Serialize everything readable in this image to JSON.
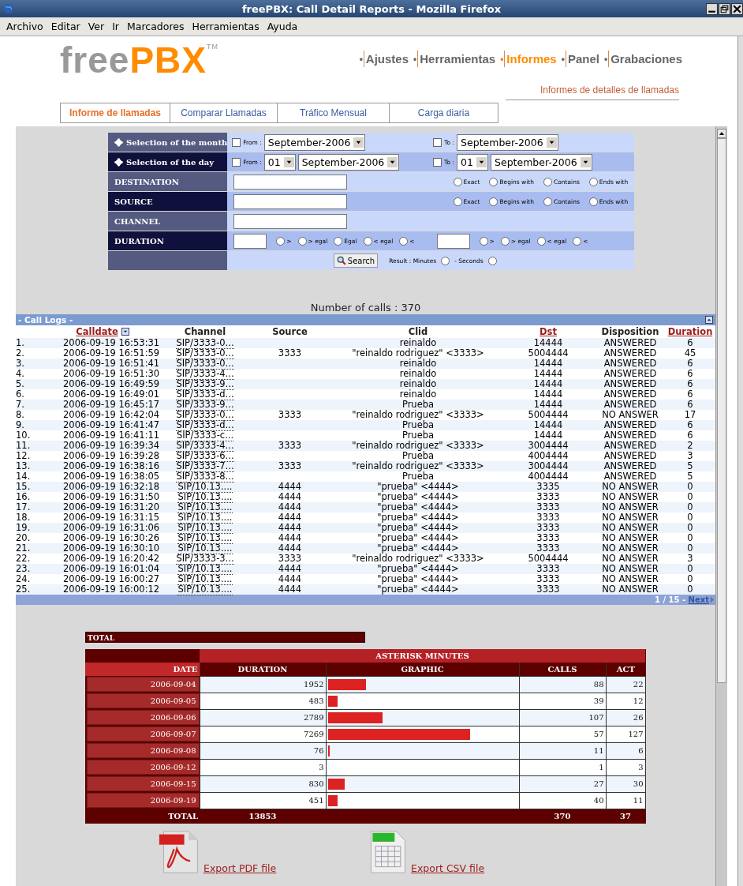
{
  "window": {
    "title": "freePBX: Call Detail Reports - Mozilla Firefox"
  },
  "menu": [
    "Archivo",
    "Editar",
    "Ver",
    "Ir",
    "Marcadores",
    "Herramientas",
    "Ayuda"
  ],
  "logo": {
    "first": "free",
    "second": "PBX",
    "mark": "TM"
  },
  "nav": [
    {
      "bullet": "•",
      "label": "Ajustes",
      "selected": false
    },
    {
      "bullet": "•",
      "label": "Herramientas",
      "selected": false
    },
    {
      "bullet": "•",
      "label": "Informes",
      "selected": true
    },
    {
      "bullet": "•",
      "label": "Panel",
      "selected": false
    },
    {
      "bullet": "•",
      "label": "Grabaciones",
      "selected": false
    }
  ],
  "subtitle": "Informes de detalles de llamadas",
  "tabs": [
    {
      "label": "Informe de llamadas",
      "selected": true
    },
    {
      "label": "Comparar Llamadas",
      "selected": false
    },
    {
      "label": "Tráfico Mensual",
      "selected": false
    },
    {
      "label": "Carga diaria",
      "selected": false
    }
  ],
  "form": {
    "rows": [
      {
        "kind": "month",
        "label": "Selection of the month",
        "from": {
          "label": "From :",
          "checked": false,
          "month": "September-2006"
        },
        "to": {
          "label": "To :",
          "checked": false,
          "month": "September-2006"
        }
      },
      {
        "kind": "day",
        "label": "Selection of the day",
        "from": {
          "label": "From :",
          "checked": false,
          "day": "01",
          "month": "September-2006"
        },
        "to": {
          "label": "To :",
          "checked": false,
          "day": "01",
          "month": "September-2006"
        }
      },
      {
        "kind": "match",
        "label": "DESTINATION",
        "options": [
          {
            "label": "Exact",
            "selected": false
          },
          {
            "label": "Begins with",
            "selected": false
          },
          {
            "label": "Contains",
            "selected": false
          },
          {
            "label": "Ends with",
            "selected": false
          }
        ]
      },
      {
        "kind": "match",
        "label": "SOURCE",
        "options": [
          {
            "label": "Exact",
            "selected": false
          },
          {
            "label": "Begins with",
            "selected": false
          },
          {
            "label": "Contains",
            "selected": false
          },
          {
            "label": "Ends with",
            "selected": false
          }
        ]
      },
      {
        "kind": "text",
        "label": "CHANNEL"
      },
      {
        "kind": "duration",
        "label": "DURATION",
        "options": [
          {
            "label": ">",
            "selected": false
          },
          {
            "label": "> egal",
            "selected": false
          },
          {
            "label": "Egal",
            "selected": false
          },
          {
            "label": "< egal",
            "selected": false
          },
          {
            "label": "<",
            "selected": false
          }
        ],
        "options2": [
          {
            "label": ">",
            "selected": false
          },
          {
            "label": "> egal",
            "selected": false
          },
          {
            "label": "< egal",
            "selected": false
          },
          {
            "label": "<",
            "selected": false
          }
        ]
      },
      {
        "kind": "search",
        "button": "Search",
        "minutes": {
          "label": "Result : Minutes",
          "selected": false
        },
        "seconds": {
          "label": "- Seconds",
          "selected": false
        }
      }
    ]
  },
  "calls_count": "Number of calls : 370",
  "logs": {
    "title": "- Call Logs -",
    "columns": [
      {
        "label": "Calldate",
        "link": true,
        "sort": true
      },
      {
        "label": "Channel",
        "link": false
      },
      {
        "label": "Source",
        "link": false
      },
      {
        "label": "Clid",
        "link": false
      },
      {
        "label": "Dst",
        "link": true
      },
      {
        "label": "Disposition",
        "link": false
      },
      {
        "label": "Duration",
        "link": true
      }
    ],
    "rows": [
      {
        "no": "1.",
        "cells": [
          "2006-09-19 16:53:31",
          "SIP/3333-0...",
          "",
          "reinaldo",
          "14444",
          "ANSWERED",
          "6"
        ]
      },
      {
        "no": "2.",
        "cells": [
          "2006-09-19 16:51:59",
          "SIP/3333-0...",
          "3333",
          "\"reinaldo rodriguez\" <3333>",
          "5004444",
          "ANSWERED",
          "45"
        ]
      },
      {
        "no": "3.",
        "cells": [
          "2006-09-19 16:51:41",
          "SIP/3333-0...",
          "",
          "reinaldo",
          "14444",
          "ANSWERED",
          "6"
        ]
      },
      {
        "no": "4.",
        "cells": [
          "2006-09-19 16:51:30",
          "SIP/3333-4...",
          "",
          "reinaldo",
          "14444",
          "ANSWERED",
          "6"
        ]
      },
      {
        "no": "5.",
        "cells": [
          "2006-09-19 16:49:59",
          "SIP/3333-9...",
          "",
          "reinaldo",
          "14444",
          "ANSWERED",
          "6"
        ]
      },
      {
        "no": "6.",
        "cells": [
          "2006-09-19 16:49:01",
          "SIP/3333-d...",
          "",
          "reinaldo",
          "14444",
          "ANSWERED",
          "6"
        ]
      },
      {
        "no": "7.",
        "cells": [
          "2006-09-19 16:45:17",
          "SIP/3333-9...",
          "",
          "Prueba",
          "14444",
          "ANSWERED",
          "6"
        ]
      },
      {
        "no": "8.",
        "cells": [
          "2006-09-19 16:42:04",
          "SIP/3333-0...",
          "3333",
          "\"reinaldo rodriguez\" <3333>",
          "5004444",
          "NO ANSWER",
          "17"
        ]
      },
      {
        "no": "9.",
        "cells": [
          "2006-09-19 16:41:47",
          "SIP/3333-d...",
          "",
          "Prueba",
          "14444",
          "ANSWERED",
          "6"
        ]
      },
      {
        "no": "10.",
        "cells": [
          "2006-09-19 16:41:11",
          "SIP/3333-c...",
          "",
          "Prueba",
          "14444",
          "ANSWERED",
          "6"
        ]
      },
      {
        "no": "11.",
        "cells": [
          "2006-09-19 16:39:34",
          "SIP/3333-4...",
          "3333",
          "\"reinaldo rodriguez\" <3333>",
          "3004444",
          "ANSWERED",
          "2"
        ]
      },
      {
        "no": "12.",
        "cells": [
          "2006-09-19 16:39:28",
          "SIP/3333-6...",
          "",
          "Prueba",
          "4004444",
          "ANSWERED",
          "3"
        ]
      },
      {
        "no": "13.",
        "cells": [
          "2006-09-19 16:38:16",
          "SIP/3333-7...",
          "3333",
          "\"reinaldo rodriguez\" <3333>",
          "3004444",
          "ANSWERED",
          "5"
        ]
      },
      {
        "no": "14.",
        "cells": [
          "2006-09-19 16:38:05",
          "SIP/3333-8...",
          "",
          "Prueba",
          "4004444",
          "ANSWERED",
          "5"
        ]
      },
      {
        "no": "15.",
        "cells": [
          "2006-09-19 16:32:18",
          "SIP/10.13....",
          "4444",
          "\"prueba\" <4444>",
          "3335",
          "NO ANSWER",
          "0"
        ]
      },
      {
        "no": "16.",
        "cells": [
          "2006-09-19 16:31:50",
          "SIP/10.13....",
          "4444",
          "\"prueba\" <4444>",
          "3333",
          "NO ANSWER",
          "0"
        ]
      },
      {
        "no": "17.",
        "cells": [
          "2006-09-19 16:31:20",
          "SIP/10.13....",
          "4444",
          "\"prueba\" <4444>",
          "3333",
          "NO ANSWER",
          "0"
        ]
      },
      {
        "no": "18.",
        "cells": [
          "2006-09-19 16:31:15",
          "SIP/10.13....",
          "4444",
          "\"prueba\" <4444>",
          "3333",
          "NO ANSWER",
          "0"
        ]
      },
      {
        "no": "19.",
        "cells": [
          "2006-09-19 16:31:06",
          "SIP/10.13....",
          "4444",
          "\"prueba\" <4444>",
          "3333",
          "NO ANSWER",
          "0"
        ]
      },
      {
        "no": "20.",
        "cells": [
          "2006-09-19 16:30:26",
          "SIP/10.13....",
          "4444",
          "\"prueba\" <4444>",
          "3333",
          "NO ANSWER",
          "0"
        ]
      },
      {
        "no": "21.",
        "cells": [
          "2006-09-19 16:30:10",
          "SIP/10.13....",
          "4444",
          "\"prueba\" <4444>",
          "3333",
          "NO ANSWER",
          "0"
        ]
      },
      {
        "no": "22.",
        "cells": [
          "2006-09-19 16:20:42",
          "SIP/3333-3...",
          "3333",
          "\"reinaldo rodriguez\" <3333>",
          "5004444",
          "NO ANSWER",
          "3"
        ]
      },
      {
        "no": "23.",
        "cells": [
          "2006-09-19 16:01:04",
          "SIP/10.13....",
          "4444",
          "\"prueba\" <4444>",
          "3333",
          "NO ANSWER",
          "0"
        ]
      },
      {
        "no": "24.",
        "cells": [
          "2006-09-19 16:00:27",
          "SIP/10.13....",
          "4444",
          "\"prueba\" <4444>",
          "3333",
          "NO ANSWER",
          "0"
        ]
      },
      {
        "no": "25.",
        "cells": [
          "2006-09-19 16:00:12",
          "SIP/10.13....",
          "4444",
          "\"prueba\" <4444>",
          "3333",
          "NO ANSWER",
          "0"
        ]
      }
    ],
    "pages": "1 / 15 - ",
    "next": "Next"
  },
  "summary": {
    "title": "TOTAL",
    "group": "ASTERISK MINUTES",
    "columns": [
      "DATE",
      "DURATION",
      "GRAPHIC",
      "CALLS",
      "ACT"
    ],
    "rows": [
      {
        "date": "2006-09-04",
        "duration": "1952",
        "level": 0.2,
        "calls": "88",
        "act": "22"
      },
      {
        "date": "2006-09-05",
        "duration": "483",
        "level": 0.05,
        "calls": "39",
        "act": "12"
      },
      {
        "date": "2006-09-06",
        "duration": "2789",
        "level": 0.29,
        "calls": "107",
        "act": "26"
      },
      {
        "date": "2006-09-07",
        "duration": "7269",
        "level": 0.75,
        "calls": "57",
        "act": "127"
      },
      {
        "date": "2006-09-08",
        "duration": "76",
        "level": 0.01,
        "calls": "11",
        "act": "6"
      },
      {
        "date": "2006-09-12",
        "duration": "3",
        "calls": "1",
        "act": "3"
      },
      {
        "date": "2006-09-15",
        "duration": "830",
        "level": 0.09,
        "calls": "27",
        "act": "30"
      },
      {
        "date": "2006-09-19",
        "duration": "451",
        "level": 0.05,
        "calls": "40",
        "act": "11"
      }
    ],
    "total": {
      "label": "TOTAL",
      "duration": "13853",
      "calls": "370",
      "act": "37"
    }
  },
  "exports": [
    {
      "kind": "pdf",
      "label": "Export PDF file"
    },
    {
      "kind": "csv",
      "label": "Export CSV file"
    }
  ]
}
